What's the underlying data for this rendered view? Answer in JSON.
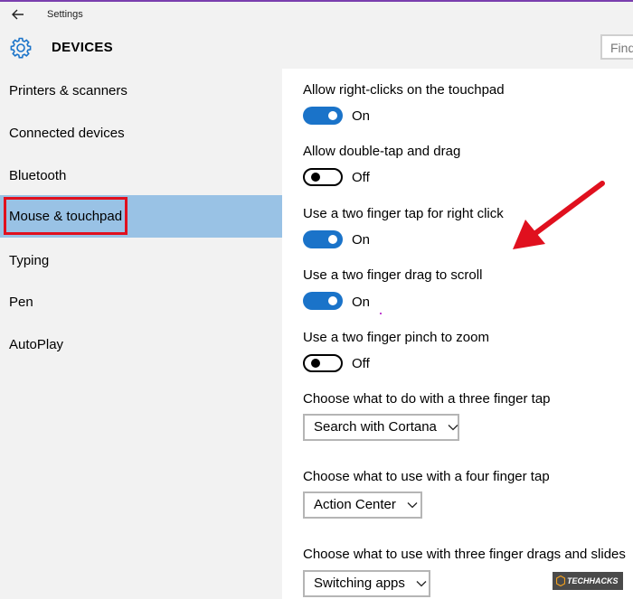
{
  "window": {
    "title": "Settings"
  },
  "header": {
    "title": "DEVICES",
    "search_placeholder": "Find"
  },
  "sidebar": {
    "items": [
      {
        "label": "Printers & scanners"
      },
      {
        "label": "Connected devices"
      },
      {
        "label": "Bluetooth"
      },
      {
        "label": "Mouse & touchpad",
        "selected": true
      },
      {
        "label": "Typing"
      },
      {
        "label": "Pen"
      },
      {
        "label": "AutoPlay"
      }
    ]
  },
  "settings": {
    "right_click": {
      "label": "Allow right-clicks on the touchpad",
      "state": "On"
    },
    "double_tap_drag": {
      "label": "Allow double-tap and drag",
      "state": "Off"
    },
    "two_finger_tap": {
      "label": "Use a two finger tap for right click",
      "state": "On"
    },
    "two_finger_scroll": {
      "label": "Use a two finger drag to scroll",
      "state": "On"
    },
    "two_finger_pinch": {
      "label": "Use a two finger pinch to zoom",
      "state": "Off"
    },
    "three_finger_tap": {
      "label": "Choose what to do with a three finger tap",
      "value": "Search with Cortana"
    },
    "four_finger_tap": {
      "label": "Choose what to use with a four finger tap",
      "value": "Action Center"
    },
    "three_finger_drag": {
      "label": "Choose what to use with three finger drags and slides",
      "value": "Switching apps"
    }
  },
  "colors": {
    "accent": "#1a73c9",
    "selected_nav": "#99c2e5",
    "annotation": "#e0101e"
  },
  "watermark": {
    "text": "TECHHACKS"
  }
}
